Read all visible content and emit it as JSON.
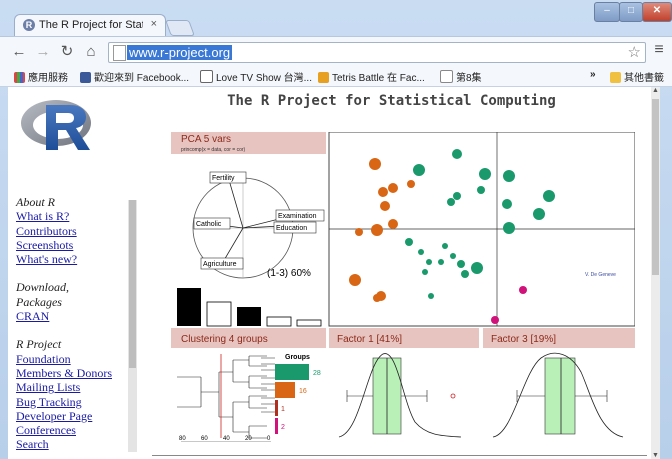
{
  "browser": {
    "tab_title": "The R Project for Statistic",
    "tab_close": "×",
    "url": "www.r-project.org",
    "window_buttons": {
      "minimize": "–",
      "maximize": "□",
      "close": "✕"
    }
  },
  "bookmarks": {
    "apps": "應用服務",
    "facebook": "歡迎來到 Facebook...",
    "lovetv": "Love TV Show 台灣...",
    "tetris": "Tetris Battle 在 Fac...",
    "episode": "第8集",
    "overflow": "»",
    "other": "其他書籤"
  },
  "page": {
    "title": "The R Project for Statistical Computing"
  },
  "sidebar": {
    "about_heading": "About R",
    "about_links": [
      "What is R?",
      "Contributors",
      "Screenshots",
      "What's new?"
    ],
    "download_heading_1": "Download,",
    "download_heading_2": "Packages",
    "download_links": [
      "CRAN"
    ],
    "project_heading": "R Project",
    "project_links": [
      "Foundation",
      "Members & Donors",
      "Mailing Lists",
      "Bug Tracking",
      "Developer Page",
      "Conferences",
      "Search"
    ]
  },
  "figure": {
    "pca_title": "PCA  5 vars",
    "pca_subtitle": "princomp(x = data, cor = cor)",
    "vars": [
      "Fertility",
      "Catholic",
      "Examination",
      "Education",
      "Agriculture"
    ],
    "variance_label": "(1-3) 60%",
    "scatter_label": "V. De Geneve",
    "clustering_title": "Clustering  4 groups",
    "groups_label": "Groups",
    "group_counts": [
      "28",
      "16",
      "1",
      "2"
    ],
    "dendro_ticks": [
      "80",
      "60",
      "40",
      "20",
      "0"
    ],
    "factor1_title": "Factor 1 [41%]",
    "factor3_title": "Factor 3 [19%]",
    "colors": {
      "orange": "#d86614",
      "green": "#1a9a6c",
      "magenta": "#d0127a",
      "header": "#e8c4c0"
    }
  }
}
